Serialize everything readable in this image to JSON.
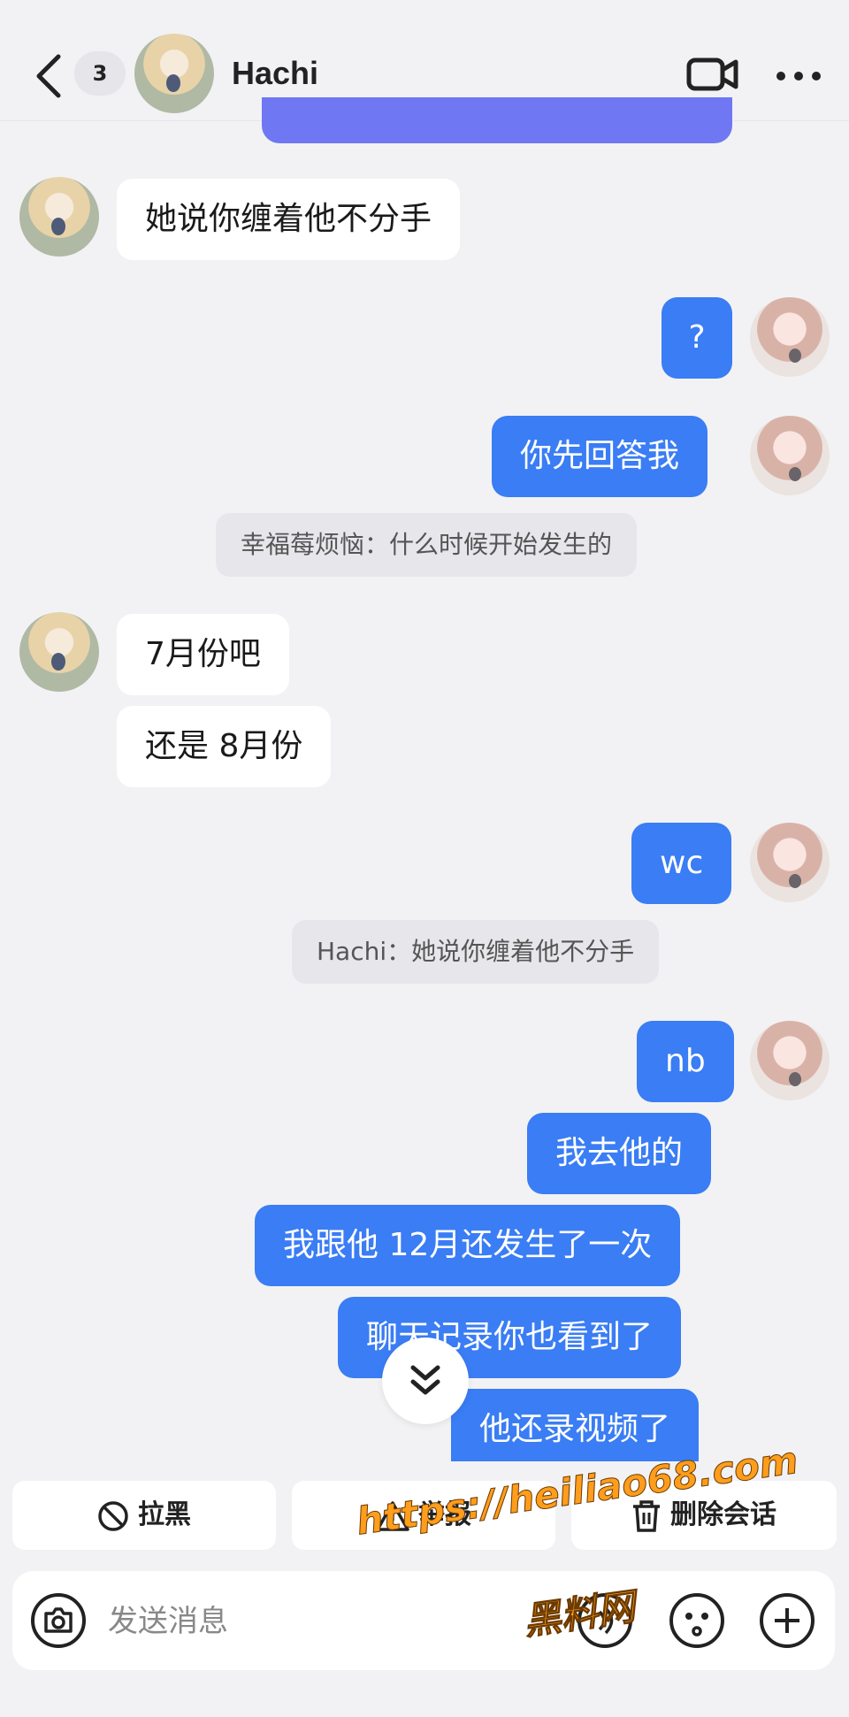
{
  "header": {
    "unread_count": "3",
    "contact_name": "Hachi"
  },
  "messages": [
    {
      "side": "left",
      "text": "她说你缠着他不分手"
    },
    {
      "side": "right",
      "text": "?"
    },
    {
      "side": "right",
      "text": "你先回答我"
    },
    {
      "side": "quote",
      "text": "幸福莓烦恼：什么时候开始发生的"
    },
    {
      "side": "left",
      "text": "7月份吧"
    },
    {
      "side": "left",
      "text": "还是 8月份"
    },
    {
      "side": "right",
      "text": "wc"
    },
    {
      "side": "quote",
      "text": "Hachi：她说你缠着他不分手"
    },
    {
      "side": "right",
      "text": "nb"
    },
    {
      "side": "right",
      "text": "我去他的"
    },
    {
      "side": "right",
      "text": "我跟他 12月还发生了一次"
    },
    {
      "side": "right",
      "text": "聊天记录你也看到了"
    },
    {
      "side": "right",
      "text": "他还录视频了"
    }
  ],
  "actions": {
    "block_label": "拉黑",
    "report_label": "举报",
    "delete_label": "删除会话"
  },
  "input": {
    "placeholder": "发送消息"
  },
  "watermark": {
    "line1": "https://heiliao68.com",
    "line2": "黑料网"
  },
  "colors": {
    "sent_bubble": "#3a7df4",
    "received_bubble": "#ffffff",
    "background": "#f2f2f4"
  }
}
